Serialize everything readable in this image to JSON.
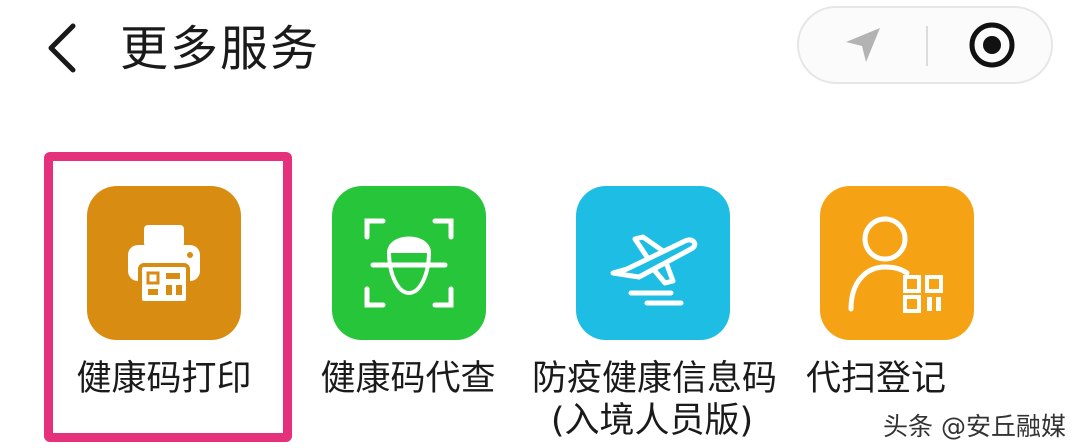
{
  "header": {
    "title": "更多服务",
    "back_icon": "chevron-left-icon",
    "capsule": {
      "location_icon": "navigation-arrow-icon",
      "record_icon": "record-circle-icon"
    }
  },
  "services": [
    {
      "label": "健康码打印",
      "sublabel": "",
      "icon": "printer-icon",
      "color": "#d88c12",
      "highlighted": true
    },
    {
      "label": "健康码代查",
      "sublabel": "",
      "icon": "face-scan-icon",
      "color": "#27c63a",
      "highlighted": false
    },
    {
      "label": "防疫健康信息码",
      "sublabel": "(入境人员版)",
      "icon": "airplane-icon",
      "color": "#1ebde3",
      "highlighted": false
    },
    {
      "label": "代扫登记",
      "sublabel": "",
      "icon": "person-qr-icon",
      "color": "#f5a314",
      "highlighted": false
    }
  ],
  "highlight_color": "#e5317c",
  "watermark": "头条 @安丘融媒"
}
